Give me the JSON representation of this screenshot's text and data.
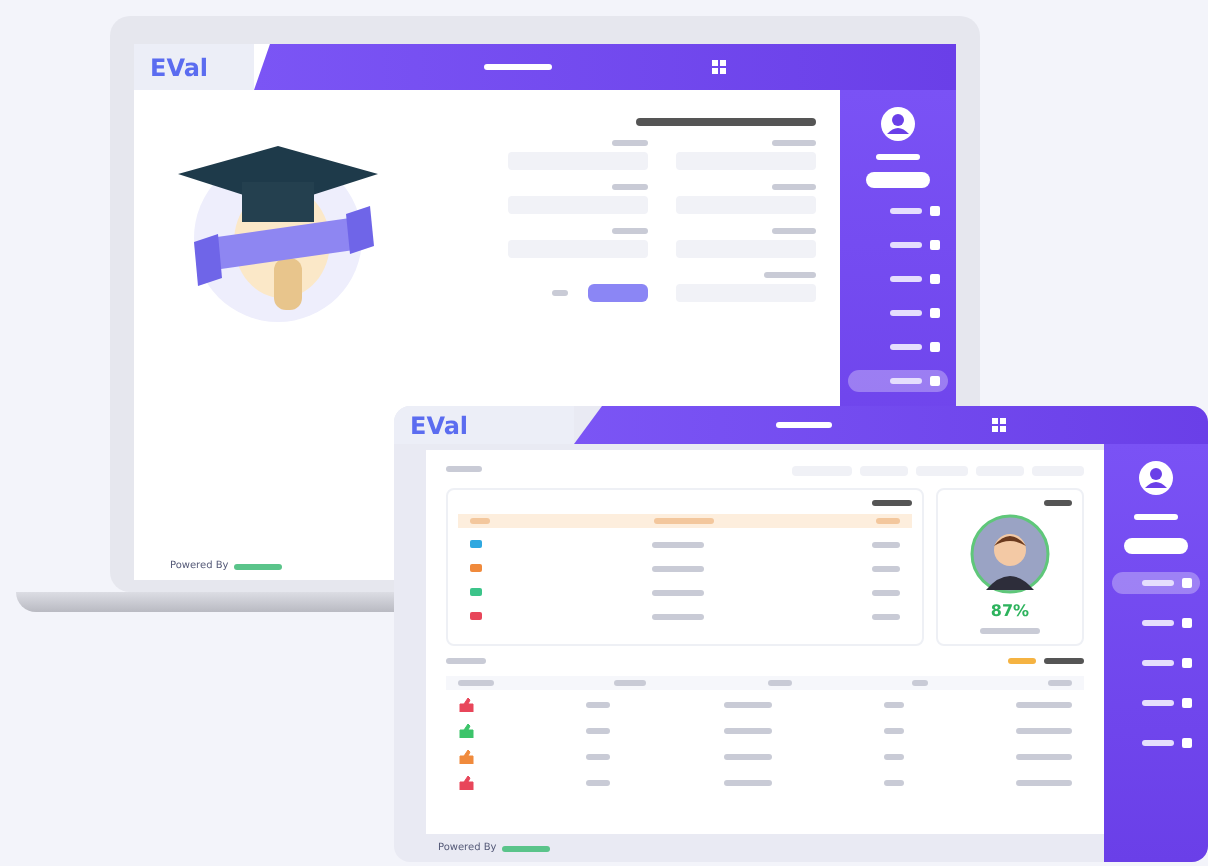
{
  "laptop": {
    "logo": "EVal",
    "footer": "Powered By",
    "sidebar_items": [
      {
        "selected": false
      },
      {
        "selected": false
      },
      {
        "selected": false
      },
      {
        "selected": false
      },
      {
        "selected": false
      },
      {
        "selected": true
      }
    ]
  },
  "window": {
    "logo": "EVal",
    "score": "87%",
    "footer": "Powered By",
    "sidebar_items": [
      {
        "selected": true
      },
      {
        "selected": false
      },
      {
        "selected": false
      },
      {
        "selected": false
      },
      {
        "selected": false
      }
    ],
    "appointments": [
      {
        "color": "#2fa8e0"
      },
      {
        "color": "#f08a3c"
      },
      {
        "color": "#3cc48a"
      },
      {
        "color": "#e8465a"
      }
    ],
    "evaluations": [
      {
        "color": "#e8465a"
      },
      {
        "color": "#3cc46a"
      },
      {
        "color": "#f08a3c"
      },
      {
        "color": "#e8465a"
      }
    ]
  }
}
